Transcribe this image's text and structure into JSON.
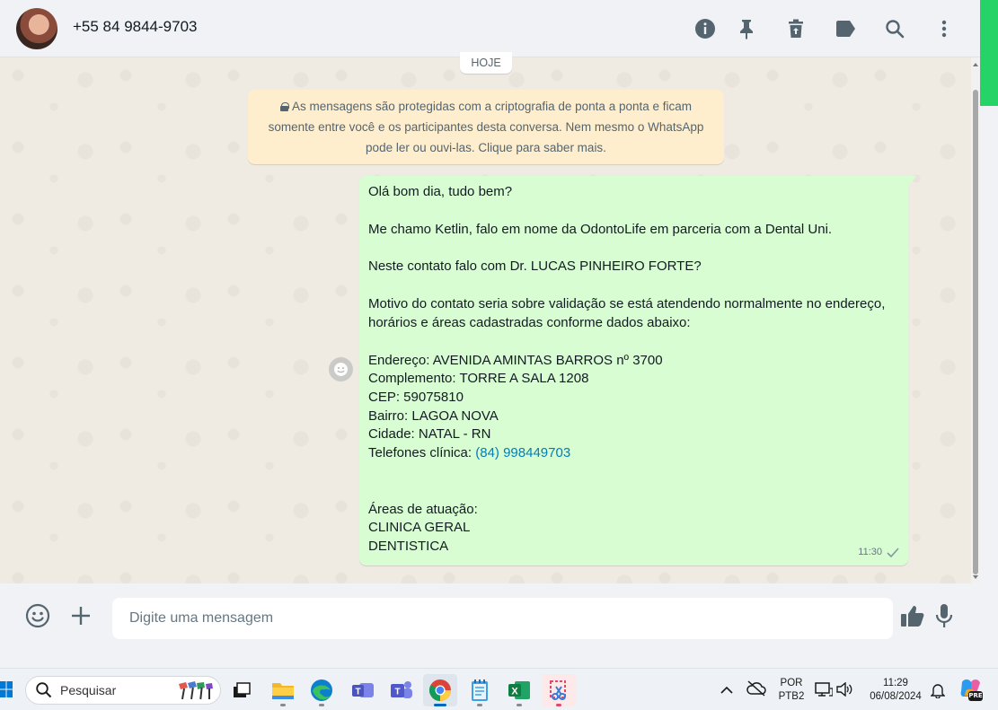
{
  "header": {
    "contact_name": "+55 84 9844-9703",
    "icons": [
      "info-icon",
      "pin-icon",
      "delete-icon",
      "label-icon",
      "search-icon",
      "menu-icon"
    ]
  },
  "chat": {
    "date_chip": "HOJE",
    "encryption_notice": "As mensagens são protegidas com a criptografia de ponta a ponta e ficam somente entre você e os participantes desta conversa. Nem mesmo o WhatsApp pode ler ou ouvi-las. Clique para saber mais.",
    "message": {
      "greeting": "Olá bom dia, tudo bem?",
      "intro": "Me chamo Ketlin, falo em nome da OdontoLife em parceria com a Dental Uni.",
      "question": "Neste contato falo com Dr. LUCAS PINHEIRO FORTE?",
      "reason": "Motivo do contato seria sobre validação se está atendendo normalmente no endereço, horários e áreas cadastradas conforme dados abaixo:",
      "address": "Endereço: AVENIDA AMINTAS BARROS nº 3700",
      "complement": "Complemento: TORRE A SALA 1208",
      "cep": "CEP: 59075810",
      "neighborhood": "Bairro: LAGOA NOVA",
      "city": "Cidade: NATAL - RN",
      "phones_label": "Telefones clínica: ",
      "phones_link": "(84) 998449703",
      "areas_label": "Áreas de atuação:",
      "area_1": "CLINICA GERAL",
      "area_2": "DENTISTICA",
      "time": "11:30",
      "status": "sent"
    }
  },
  "footer": {
    "placeholder": "Digite uma mensagem"
  },
  "taskbar": {
    "search_label": "Pesquisar",
    "lang_1": "POR",
    "lang_2": "PTB2",
    "time": "11:29",
    "date": "06/08/2024",
    "copilot_badge": "PRE"
  },
  "colors": {
    "outgoing_bubble": "#d9fdd3",
    "encryption_bg": "#ffeecd",
    "chat_bg": "#efeae2",
    "accent_green": "#25d366",
    "link": "#027eb5"
  }
}
